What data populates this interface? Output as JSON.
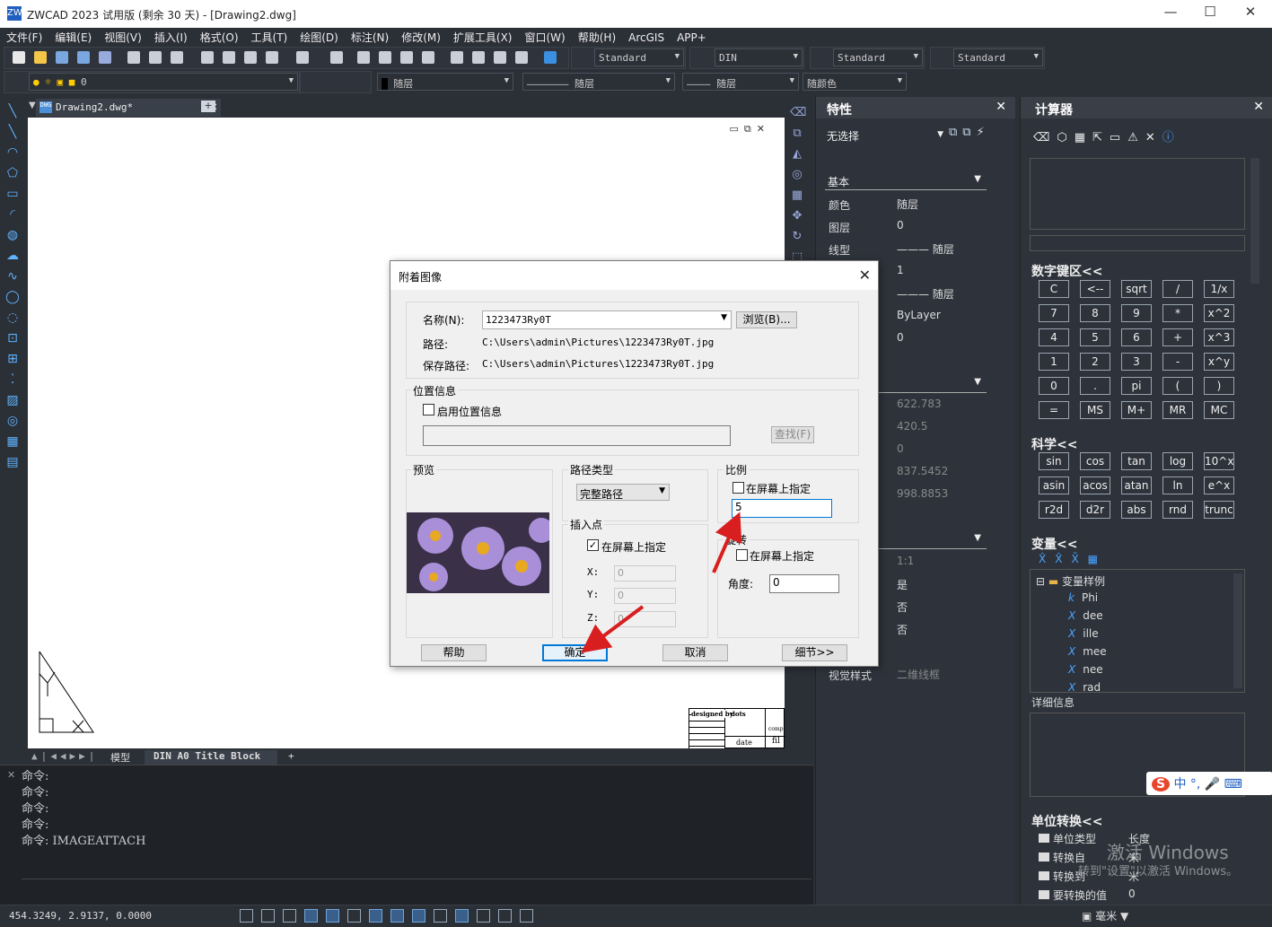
{
  "window": {
    "title": "ZWCAD 2023 试用版 (剩余 30 天) - [Drawing2.dwg]",
    "logo": "ZW"
  },
  "menu": [
    "文件(F)",
    "编辑(E)",
    "视图(V)",
    "插入(I)",
    "格式(O)",
    "工具(T)",
    "绘图(D)",
    "标注(N)",
    "修改(M)",
    "扩展工具(X)",
    "窗口(W)",
    "帮助(H)",
    "ArcGIS",
    "APP+"
  ],
  "toolbar": {
    "text_style": "Standard",
    "dim_style": "DIN",
    "table_style": "Standard",
    "mleader_style": "Standard",
    "layer": "0",
    "color": "随层",
    "linetype": "随层",
    "lineweight": "随层",
    "plotstyle": "随颜色"
  },
  "doc_tab": {
    "label": "Drawing2.dwg*"
  },
  "layout_tabs": {
    "model": "模型",
    "layout": "DIN A0 Title Block",
    "add": "+"
  },
  "titleblock": {
    "designed": "designed by",
    "date": "date",
    "comp": "comp",
    "fil": "fil",
    "dots": "dots"
  },
  "command": {
    "history": [
      "命令:",
      "命令:",
      "命令:",
      "命令:",
      "命令: IMAGEATTACH"
    ]
  },
  "status": {
    "coords": "454.3249, 2.9137, 0.0000",
    "unit": "毫米"
  },
  "properties": {
    "title": "特性",
    "selection": "无选择",
    "section_basic": "基本",
    "rows": [
      {
        "k": "颜色",
        "v": "随层"
      },
      {
        "k": "图层",
        "v": "0"
      },
      {
        "k": "线型",
        "v": "——— 随层"
      },
      {
        "k": "",
        "v": "1"
      },
      {
        "k": "",
        "v": "——— 随层"
      },
      {
        "k": "",
        "v": "ByLayer"
      },
      {
        "k": "",
        "v": "0"
      }
    ],
    "geom": [
      "622.783",
      "420.5",
      "0",
      "837.5452",
      "998.8853"
    ],
    "misc": [
      "1:1",
      "是",
      "否",
      "否"
    ],
    "visual_style_k": "视觉样式",
    "visual_style_v": "二维线框"
  },
  "calculator": {
    "title": "计算器",
    "numpad_title": "数字键区<<",
    "numpad": [
      [
        "C",
        "<--",
        "sqrt",
        "/",
        "1/x"
      ],
      [
        "7",
        "8",
        "9",
        "*",
        "x^2"
      ],
      [
        "4",
        "5",
        "6",
        "+",
        "x^3"
      ],
      [
        "1",
        "2",
        "3",
        "-",
        "x^y"
      ],
      [
        "0",
        ".",
        "pi",
        "(",
        ")"
      ],
      [
        "=",
        "MS",
        "M+",
        "MR",
        "MC"
      ]
    ],
    "sci_title": "科学<<",
    "sci": [
      [
        "sin",
        "cos",
        "tan",
        "log",
        "10^x"
      ],
      [
        "asin",
        "acos",
        "atan",
        "ln",
        "e^x"
      ],
      [
        "r2d",
        "d2r",
        "abs",
        "rnd",
        "trunc"
      ]
    ],
    "var_title": "变量<<",
    "var_folder": "变量样例",
    "vars": [
      {
        "p": "k",
        "n": "Phi"
      },
      {
        "p": "X",
        "n": "dee"
      },
      {
        "p": "X",
        "n": "ille"
      },
      {
        "p": "X",
        "n": "mee"
      },
      {
        "p": "X",
        "n": "nee"
      },
      {
        "p": "X",
        "n": "rad"
      }
    ],
    "detail": "详细信息",
    "unit_title": "单位转换<<",
    "unit_rows": [
      {
        "k": "单位类型",
        "v": "长度"
      },
      {
        "k": "转换自",
        "v": "米"
      },
      {
        "k": "转换到",
        "v": "米"
      },
      {
        "k": "要转换的值",
        "v": "0"
      }
    ]
  },
  "watermark": {
    "line1": "激活 Windows",
    "line2": "转到\"设置\"以激活 Windows。",
    "ime": "中 °, 🎤 ⌨"
  },
  "dialog": {
    "title": "附着图像",
    "name_label": "名称(N):",
    "name_value": "1223473Ry0T",
    "browse": "浏览(B)...",
    "path_label": "路径:",
    "path_value": "C:\\Users\\admin\\Pictures\\1223473Ry0T.jpg",
    "save_path_label": "保存路径:",
    "save_path_value": "C:\\Users\\admin\\Pictures\\1223473Ry0T.jpg",
    "location_group": "位置信息",
    "enable_location": "启用位置信息",
    "find": "查找(F)",
    "preview": "预览",
    "path_type": "路径类型",
    "path_type_value": "完整路径",
    "insert_point": "插入点",
    "specify_onscreen": "在屏幕上指定",
    "x_label": "X:",
    "x_value": "0",
    "y_label": "Y:",
    "y_value": "0",
    "z_label": "Z:",
    "z_value": "0",
    "scale": "比例",
    "scale_onscreen": "在屏幕上指定",
    "scale_value": "5",
    "rotation": "旋转",
    "rotation_onscreen": "在屏幕上指定",
    "angle_label": "角度:",
    "angle_value": "0",
    "help": "帮助",
    "ok": "确定",
    "cancel": "取消",
    "details": "细节>>"
  },
  "colors": {
    "accent": "#d81e1e",
    "dialog_focus": "#0078d7",
    "panel": "#2e333b"
  }
}
